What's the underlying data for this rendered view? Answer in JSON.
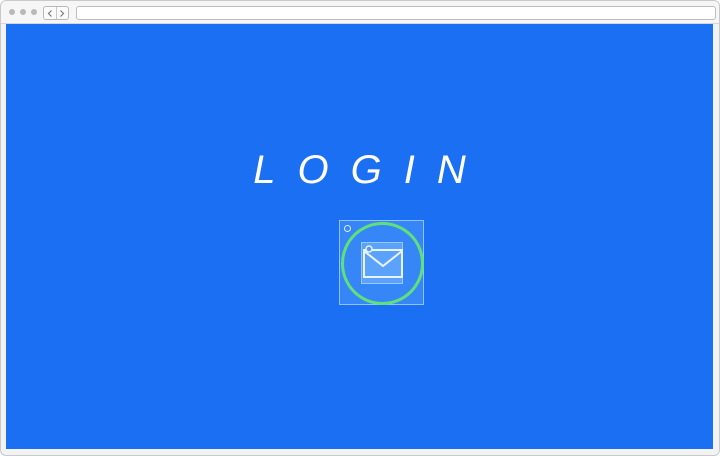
{
  "page": {
    "title": "LOGIN"
  },
  "login_options": [
    {
      "icon": "email-icon"
    }
  ],
  "colors": {
    "background": "#1b6ff2",
    "focus_ring": "#5fe07a",
    "title_text": "#ffffff"
  }
}
